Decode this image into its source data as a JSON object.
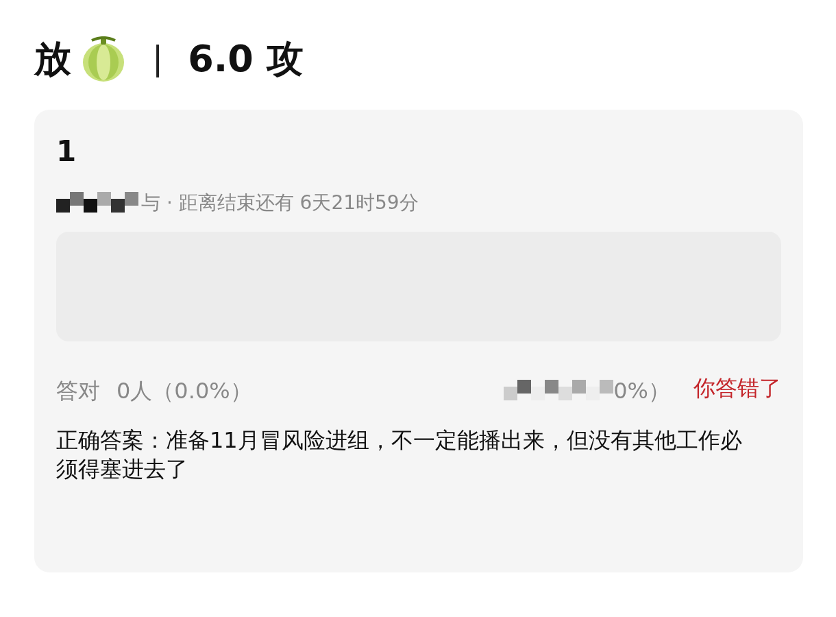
{
  "header": {
    "title_before": "放",
    "separator": "|",
    "title_after": "6.0 攻"
  },
  "card": {
    "number": "1",
    "meta": "与 · 距离结束还有 6天21时59分",
    "stats": {
      "correct_label": "答对",
      "correct_value": "0人（0.0%）",
      "wrong_value": "0%）",
      "result": "你答错了"
    },
    "answer": "正确答案：准备11月冒风险进组，不一定能播出来，但没有其他工作必须得塞进去了"
  }
}
